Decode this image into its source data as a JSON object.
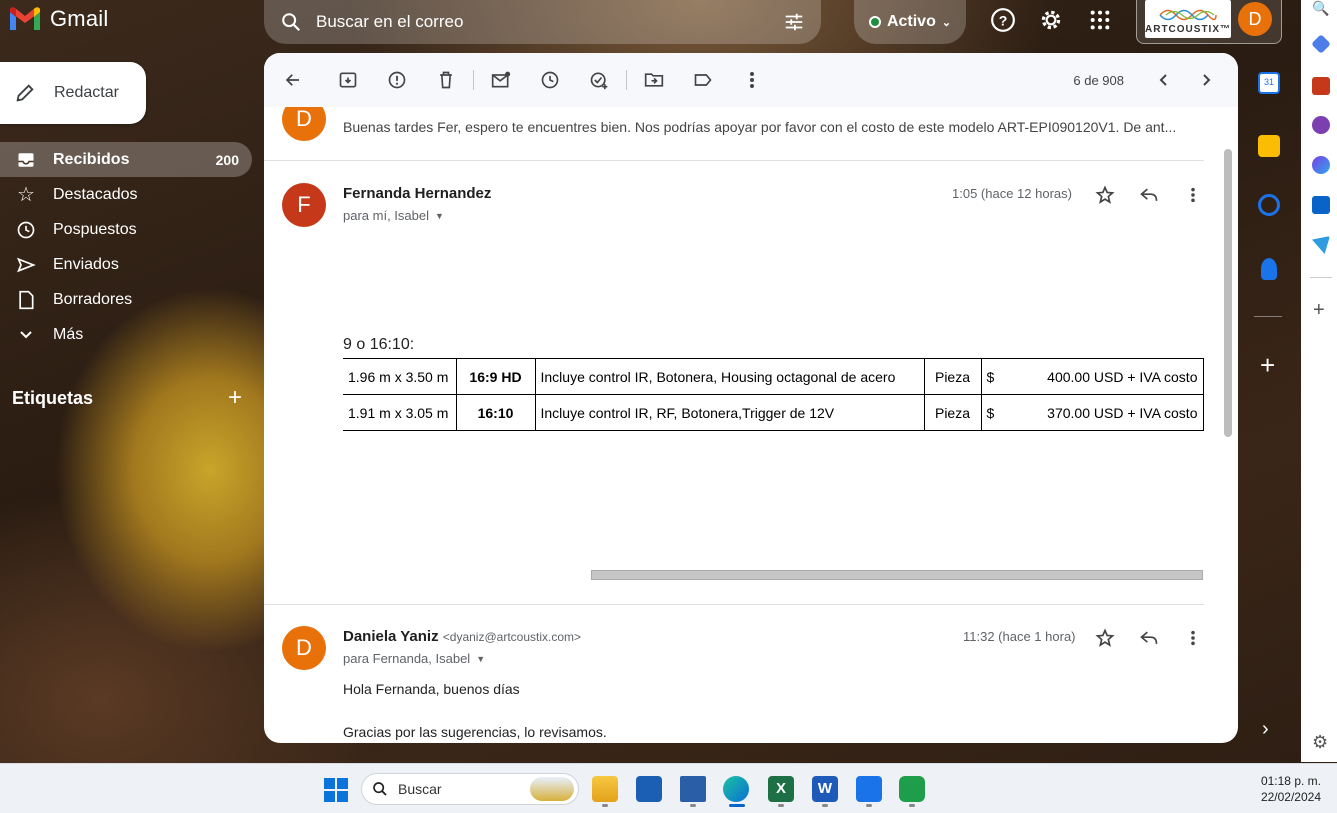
{
  "app": {
    "name": "Gmail"
  },
  "search": {
    "placeholder": "Buscar en el correo"
  },
  "status": {
    "label": "Activo",
    "color": "#1e8e3e"
  },
  "brand": {
    "name": "ARTCOUSTIX™"
  },
  "account": {
    "initial": "D",
    "color": "#e8710a"
  },
  "compose": {
    "label": "Redactar"
  },
  "nav": {
    "items": [
      {
        "label": "Recibidos",
        "count": "200",
        "icon": "inbox-icon"
      },
      {
        "label": "Destacados",
        "icon": "star-icon"
      },
      {
        "label": "Pospuestos",
        "icon": "clock-icon"
      },
      {
        "label": "Enviados",
        "icon": "send-icon"
      },
      {
        "label": "Borradores",
        "icon": "draft-icon"
      },
      {
        "label": "Más",
        "icon": "chevron-down-icon"
      }
    ],
    "labels_heading": "Etiquetas"
  },
  "toolbar": {
    "count": "6 de 908"
  },
  "thread": {
    "prev": {
      "initial": "D",
      "snippet": "Buenas tardes Fer, espero te encuentres bien. Nos podrías apoyar por favor con el costo de este modelo ART-EPI090120V1. De ant..."
    },
    "msg1": {
      "initial": "F",
      "sender": "Fernanda Hernandez",
      "recipients": "para mí, Isabel",
      "time": "1:05 (hace 12 horas)",
      "fragment": "9 o 16:10:",
      "table": [
        [
          "1.96 m x 3.50 m",
          "16:9 HD",
          "Incluye control IR, Botonera, Housing octagonal de acero",
          "Pieza",
          "$",
          "400.00 USD + IVA costo"
        ],
        [
          "1.91 m x 3.05 m",
          "16:10",
          "Incluye control IR, RF, Botonera,Trigger de  12V",
          "Pieza",
          "$",
          "370.00 USD + IVA costo"
        ]
      ]
    },
    "msg2": {
      "initial": "D",
      "sender": "Daniela Yaniz",
      "email": "<dyaniz@artcoustix.com>",
      "recipients": "para Fernanda, Isabel",
      "time": "11:32 (hace 1 hora)",
      "body": [
        "Hola Fernanda, buenos días",
        "Gracias por las sugerencias, lo revisamos."
      ]
    }
  },
  "taskbar": {
    "search": "Buscar",
    "time": "01:18 p. m.",
    "date": "22/02/2024"
  }
}
